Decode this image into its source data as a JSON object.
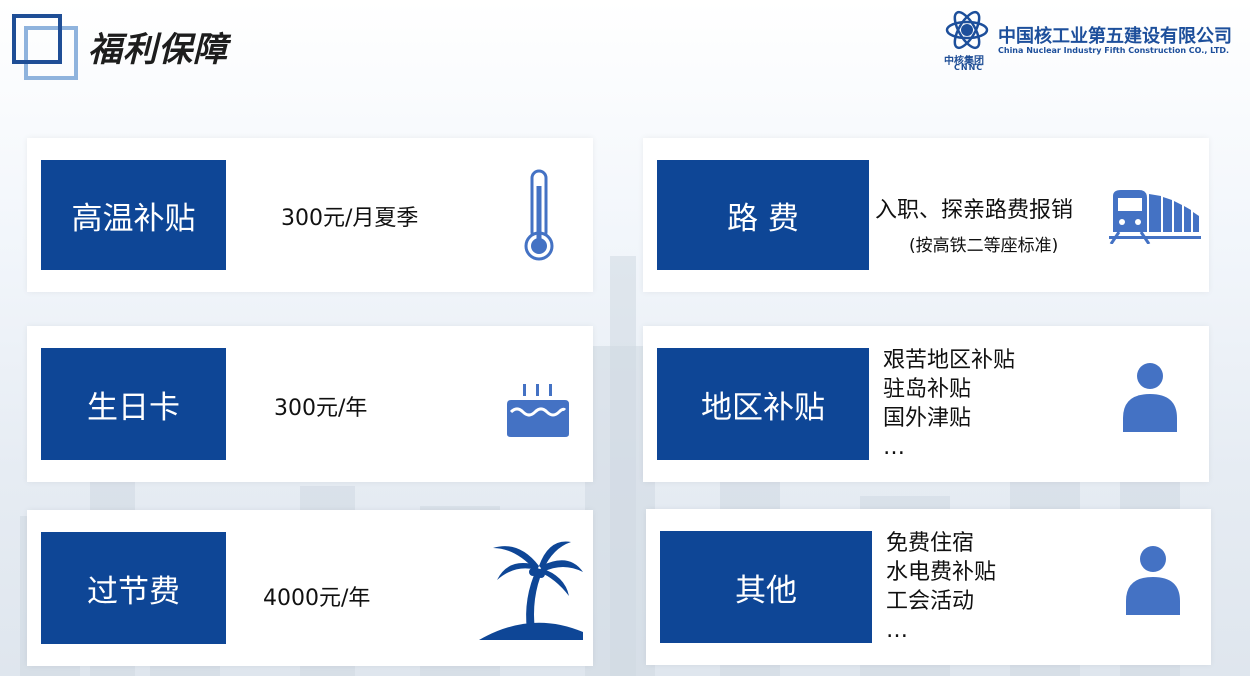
{
  "header": {
    "title": "福利保障",
    "company_cn": "中国核工业第五建设有限公司",
    "company_en": "China Nuclear Industry Fifth Construction CO., LTD.",
    "group_name": "中核集团",
    "group_abbr": "CNNC"
  },
  "cards": {
    "high_temp": {
      "label": "高温补贴",
      "value": "300元/月夏季",
      "icon": "thermometer-icon"
    },
    "travel": {
      "label": "路  费",
      "value": "入职、探亲路费报销",
      "note": "(按高铁二等座标准)",
      "icon": "train-icon"
    },
    "birthday": {
      "label": "生日卡",
      "value": "300元/年",
      "icon": "cake-icon"
    },
    "region": {
      "label": "地区补贴",
      "items": [
        "艰苦地区补贴",
        "驻岛补贴",
        "国外津贴",
        "…"
      ],
      "icon": "person-icon"
    },
    "holiday": {
      "label": "过节费",
      "value": "4000元/年",
      "icon": "palm-tree-icon"
    },
    "other": {
      "label": "其他",
      "items": [
        "免费住宿",
        "水电费补贴",
        "工会活动",
        "…"
      ],
      "icon": "person-icon"
    }
  },
  "colors": {
    "label_bg": "#0e4696",
    "icon": "#4472c4"
  }
}
